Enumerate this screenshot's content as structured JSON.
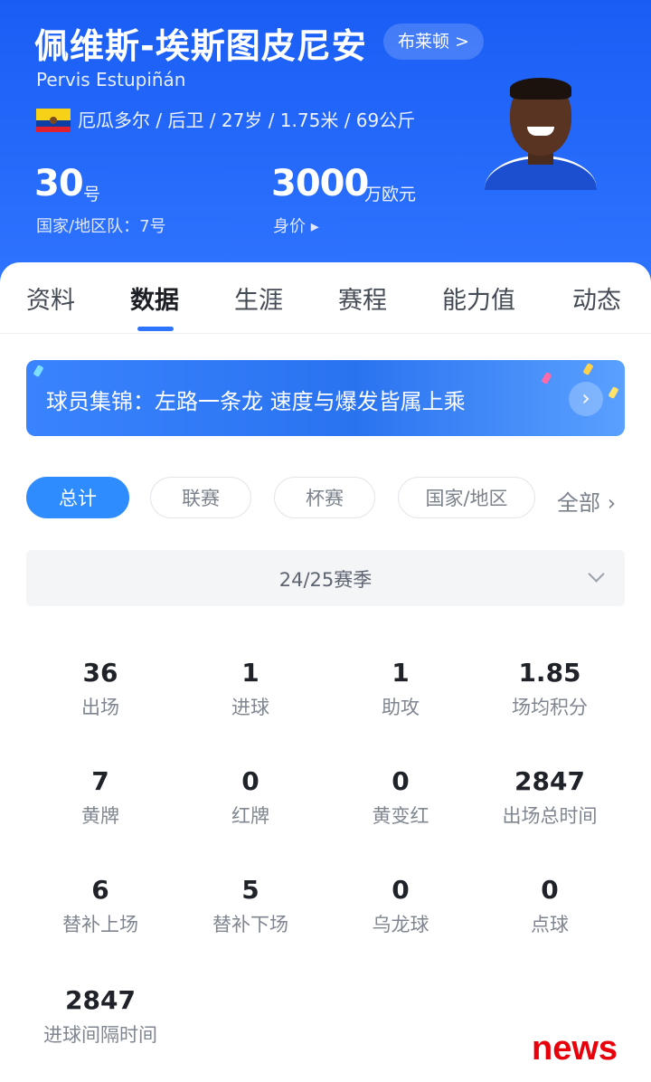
{
  "player": {
    "name_cn": "佩维斯-埃斯图皮尼安",
    "club_button": "布莱顿 >",
    "name_en": "Pervis Estupiñán",
    "bio": "厄瓜多尔 / 后卫 / 27岁 / 1.75米 / 69公斤",
    "flag_colors": [
      "#f7d117",
      "#0d3ea3",
      "#e0202c"
    ],
    "number": "30",
    "number_unit": "号",
    "national_team_number": "国家/地区队：7号",
    "market_value": "3000",
    "market_value_unit": "万欧元",
    "market_value_label": "身价 ▸"
  },
  "tabs": [
    {
      "label": "资料"
    },
    {
      "label": "数据"
    },
    {
      "label": "生涯"
    },
    {
      "label": "赛程"
    },
    {
      "label": "能力值"
    },
    {
      "label": "动态"
    }
  ],
  "active_tab": "数据",
  "banner": {
    "text": "球员集锦：左路一条龙 速度与爆发皆属上乘",
    "arrow": "›"
  },
  "filters": [
    {
      "label": "总计"
    },
    {
      "label": "联赛"
    },
    {
      "label": "杯赛"
    },
    {
      "label": "国家/地区"
    }
  ],
  "filters_more": "全部 ›",
  "season": "24/25赛季",
  "stats": [
    {
      "value": "36",
      "label": "出场"
    },
    {
      "value": "1",
      "label": "进球"
    },
    {
      "value": "1",
      "label": "助攻"
    },
    {
      "value": "1.85",
      "label": "场均积分"
    },
    {
      "value": "7",
      "label": "黄牌"
    },
    {
      "value": "0",
      "label": "红牌"
    },
    {
      "value": "0",
      "label": "黄变红"
    },
    {
      "value": "2847",
      "label": "出场总时间"
    },
    {
      "value": "6",
      "label": "替补上场"
    },
    {
      "value": "5",
      "label": "替补下场"
    },
    {
      "value": "0",
      "label": "乌龙球"
    },
    {
      "value": "0",
      "label": "点球"
    },
    {
      "value": "2847",
      "label": "进球间隔时间"
    }
  ],
  "watermark": "news",
  "colors": {
    "brand_blue": "#2f74ff",
    "chip_active": "#2f8cff",
    "watermark_red": "#e8000b"
  }
}
